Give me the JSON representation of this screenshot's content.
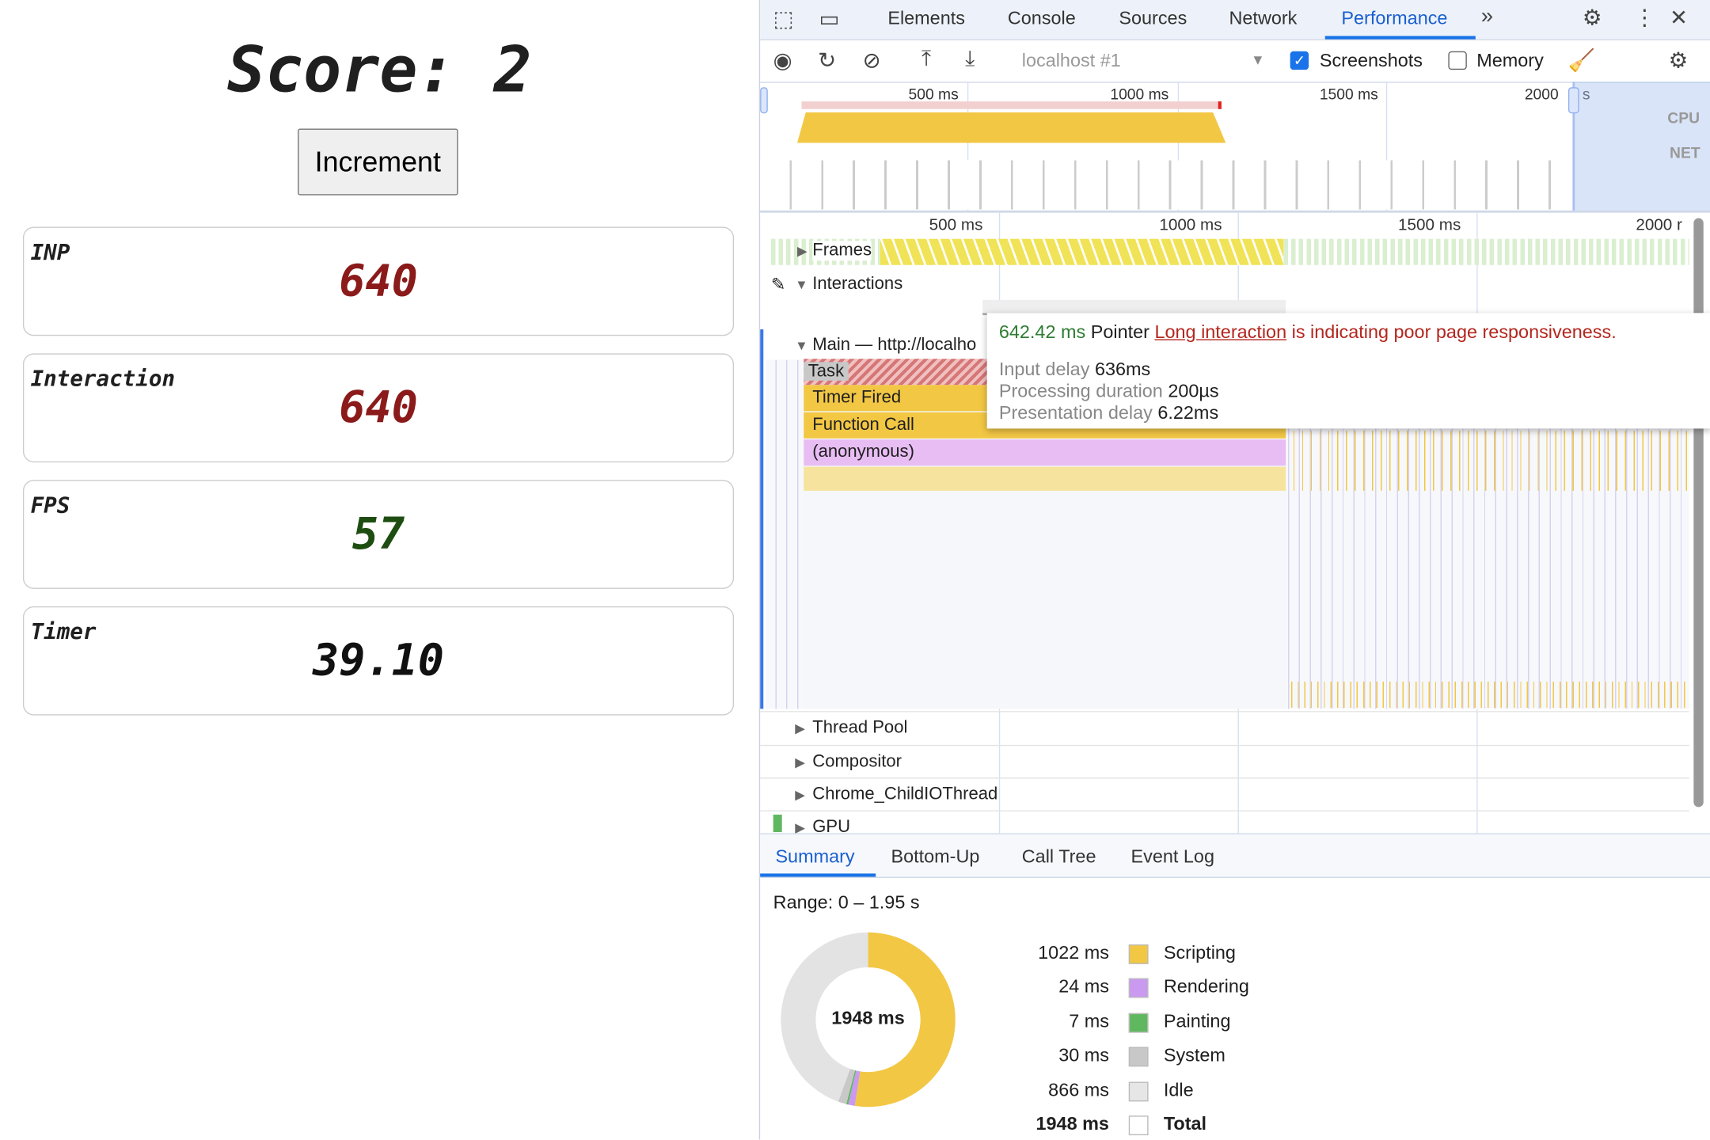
{
  "page": {
    "score_label": "Score: 2",
    "increment_button": "Increment",
    "cards": [
      {
        "label": "INP",
        "value": "640",
        "color": "#8b1a1a"
      },
      {
        "label": "Interaction",
        "value": "640",
        "color": "#8b1a1a"
      },
      {
        "label": "FPS",
        "value": "57",
        "color": "#1e4d12"
      },
      {
        "label": "Timer",
        "value": "39.10",
        "color": "#111111"
      }
    ]
  },
  "devtools": {
    "tabs": [
      "Elements",
      "Console",
      "Sources",
      "Network",
      "Performance"
    ],
    "active_tab": "Performance",
    "more_tabs_icon": "chevron-double-right-icon",
    "toolbar": {
      "target": "localhost #1",
      "screenshots_label": "Screenshots",
      "screenshots_checked": true,
      "memory_label": "Memory",
      "memory_checked": false
    },
    "overview": {
      "ticks": [
        "500 ms",
        "1000 ms",
        "1500 ms",
        "2000",
        "s"
      ],
      "cpu_label": "CPU",
      "net_label": "NET"
    },
    "timeline": {
      "ticks": [
        "500 ms",
        "1000 ms",
        "1500 ms",
        "2000 r"
      ],
      "tracks": {
        "frames": "Frames",
        "interactions": "Interactions",
        "main": "Main — http://localho",
        "thread_pool": "Thread Pool",
        "compositor": "Compositor",
        "io_thread": "Chrome_ChildIOThread",
        "gpu": "GPU"
      },
      "events": [
        "Task",
        "Timer Fired",
        "Function Call",
        "(anonymous)"
      ]
    },
    "tooltip": {
      "duration": "642.42 ms",
      "type": "Pointer",
      "link": "Long interaction",
      "message": "is indicating poor page responsiveness.",
      "rows": [
        {
          "label": "Input delay",
          "value": "636ms"
        },
        {
          "label": "Processing duration",
          "value": "200µs"
        },
        {
          "label": "Presentation delay",
          "value": "6.22ms"
        }
      ]
    },
    "bottom_tabs": [
      "Summary",
      "Bottom-Up",
      "Call Tree",
      "Event Log"
    ],
    "active_bottom_tab": "Summary",
    "summary": {
      "range": "Range: 0 – 1.95 s",
      "total_center": "1948 ms",
      "rows": [
        {
          "value": "1022 ms",
          "name": "Scripting",
          "color": "#f2c744",
          "ms": 1022
        },
        {
          "value": "24 ms",
          "name": "Rendering",
          "color": "#c99af0",
          "ms": 24
        },
        {
          "value": "7 ms",
          "name": "Painting",
          "color": "#5fb85f",
          "ms": 7
        },
        {
          "value": "30 ms",
          "name": "System",
          "color": "#c8c8c8",
          "ms": 30
        },
        {
          "value": "866 ms",
          "name": "Idle",
          "color": "#e6e6e6",
          "ms": 866
        },
        {
          "value": "1948 ms",
          "name": "Total",
          "color": "#ffffff",
          "ms": 1948
        }
      ]
    }
  }
}
